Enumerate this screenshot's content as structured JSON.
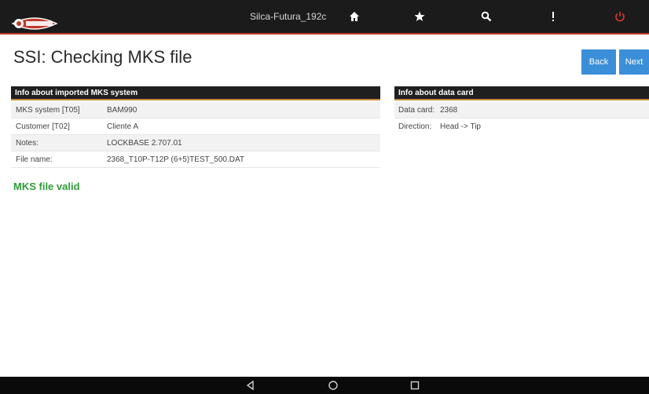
{
  "app": {
    "device_name": "Silca-Futura_192c",
    "brand_color": "#c0392b",
    "accent_color": "#3a8fd8",
    "valid_color": "#2e9c3a"
  },
  "topbar": {
    "icons": [
      "home-icon",
      "star-icon",
      "search-icon",
      "more-vertical-icon",
      "power-icon"
    ]
  },
  "page": {
    "title": "SSI: Checking MKS file",
    "back_label": "Back",
    "next_label": "Next",
    "status": "MKS file valid"
  },
  "mks_panel": {
    "header": "Info about imported MKS system",
    "rows": [
      {
        "label": "MKS system [T05]",
        "value": "BAM990"
      },
      {
        "label": "Customer [T02]",
        "value": "Cliente A"
      },
      {
        "label": "Notes:",
        "value": "LOCKBASE 2.707.01"
      },
      {
        "label": "File name:",
        "value": "2368_T10P-T12P (6+5)TEST_500.DAT"
      }
    ]
  },
  "card_panel": {
    "header": "Info about data card",
    "rows": [
      {
        "label": "Data card:",
        "value": "2368"
      },
      {
        "label": "Direction:",
        "value": "Head -> Tip"
      }
    ]
  },
  "navbar": {
    "icons": [
      "back-triangle-icon",
      "home-circle-icon",
      "recents-square-icon"
    ]
  }
}
